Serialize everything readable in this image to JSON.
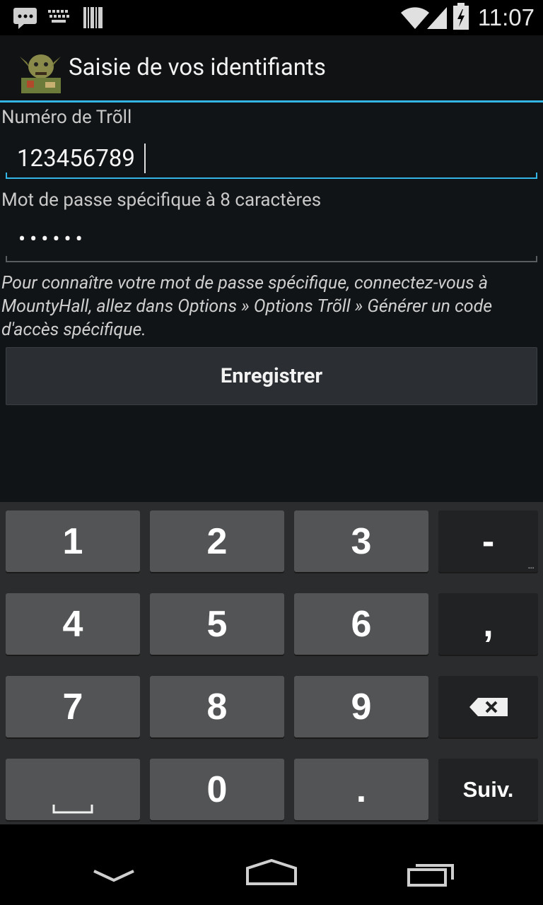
{
  "status_bar": {
    "time": "11:07",
    "icons": [
      "message-icon",
      "keyboard-icon",
      "barcode-icon",
      "wifi-icon",
      "signal-icon",
      "battery-icon"
    ]
  },
  "action_bar": {
    "title": "Saisie de vos identifiants",
    "app_icon": "troll-avatar-icon"
  },
  "form": {
    "troll_number_label": "Numéro de Trõll",
    "troll_number_value": "123456789",
    "password_label": "Mot de passe spécifique à 8 caractères",
    "password_value": "••••••",
    "hint_line1": "Pour connaître votre mot de passe spécifique, connectez-vous à",
    "hint_line2": "MountyHall, allez dans Options » Options Trõll » Générer un code",
    "hint_line3": "d'accès spécifique.",
    "save_button": "Enregistrer"
  },
  "keyboard": {
    "row1": [
      "1",
      "2",
      "3",
      "-"
    ],
    "row2": [
      "4",
      "5",
      "6",
      ","
    ],
    "row3": [
      "7",
      "8",
      "9"
    ],
    "row4": [
      "0",
      "."
    ],
    "dash_sub": "...",
    "next_label": "Suiv.",
    "delete_icon": "backspace-icon",
    "space_icon": "space-icon"
  },
  "nav_bar": {
    "icons": [
      "back-icon",
      "home-icon",
      "recents-icon"
    ]
  },
  "colors": {
    "accent": "#33b5e5",
    "background": "#111416",
    "key": "#525455",
    "key_dark": "#202223"
  }
}
